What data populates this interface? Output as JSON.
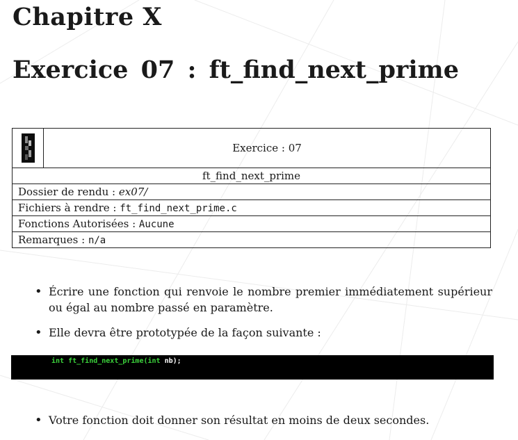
{
  "chapter_title": "Chapitre X",
  "exercise_title": "Exercice  07 : ft_find_next_prime",
  "table": {
    "header_label": "Exercice :  07",
    "function_name": "ft_find_next_prime",
    "rows": [
      {
        "label": "Dossier de rendu : ",
        "value": "ex07/",
        "style": "italic"
      },
      {
        "label": "Fichiers à rendre : ",
        "value": "ft_find_next_prime.c",
        "style": "mono"
      },
      {
        "label": "Fonctions Autorisées : ",
        "value": "Aucune",
        "style": "mono"
      },
      {
        "label": "Remarques : ",
        "value": "n/a",
        "style": "mono"
      }
    ]
  },
  "bullets": [
    "Écrire une fonction qui renvoie le nombre premier immédiatement supérieur ou égal au nombre passé en paramètre.",
    "Elle devra être prototypée de la façon suivante :"
  ],
  "code": {
    "keyword1": "int",
    "function": "ft_find_next_prime(",
    "keyword2": "int",
    "rest": " nb);",
    "colors": {
      "keyword": "#3cd33c",
      "text": "#ffffff",
      "background": "#000000"
    }
  },
  "final_bullet": "Votre fonction doit donner son résultat en moins de deux secondes."
}
